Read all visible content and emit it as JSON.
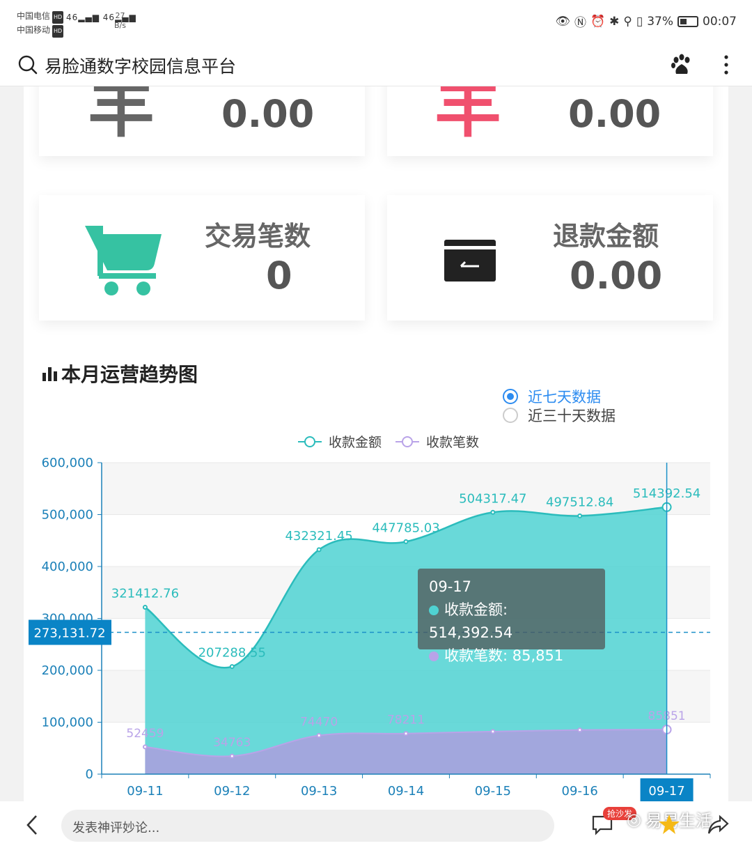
{
  "status_bar": {
    "carrier1": "中国电信",
    "carrier2": "中国移动",
    "hd": "HD",
    "signal": "46",
    "net_speed_value": "27",
    "net_speed_unit": "B/s",
    "battery": "37%",
    "time": "00:07"
  },
  "app_bar": {
    "title": "易脸通数字校园信息平台"
  },
  "cards": {
    "yen_symbol": "羊",
    "card1_value": "0.00",
    "card2_value": "0.00",
    "card3_label": "交易笔数",
    "card3_value": "0",
    "card4_label": "退款金额",
    "card4_value": "0.00"
  },
  "colors": {
    "yen_gray": "#666666",
    "yen_red": "#f0506e",
    "cart_green": "#36c2a2",
    "area_teal": "#4fd2d2",
    "line_teal": "#2bbcbc",
    "area_purple": "#a7a3dd",
    "axis_blue": "#1b80b8"
  },
  "section": {
    "title": "本月运营趋势图",
    "radio_7": "近七天数据",
    "radio_30": "近三十天数据",
    "radio_selected": "近七天数据"
  },
  "chart_data": {
    "type": "area",
    "legend": [
      "收款金额",
      "收款笔数"
    ],
    "categories": [
      "09-11",
      "09-12",
      "09-13",
      "09-14",
      "09-15",
      "09-16",
      "09-17"
    ],
    "series": [
      {
        "name": "收款金额",
        "values": [
          321412.76,
          207288.55,
          432321.45,
          447785.03,
          504317.47,
          497512.84,
          514392.54
        ],
        "labels": [
          "321412.76",
          "207288.55",
          "432321.45",
          "447785.03",
          "504317.47",
          "497512.84",
          "514392.54"
        ]
      },
      {
        "name": "收款笔数",
        "values": [
          52459,
          34763,
          74470,
          78211,
          82000,
          85000,
          85851
        ],
        "labels": [
          "52459",
          "34763",
          "74470",
          "78211",
          "",
          "",
          "85851"
        ]
      }
    ],
    "yticks": [
      "600,000",
      "500,000",
      "400,000",
      "300,000",
      "200,000",
      "100,000",
      "0"
    ],
    "ylim": [
      0,
      600000
    ],
    "crosshair_value": 273131.72,
    "crosshair_label": "273,131.72",
    "highlight_category": "09-17"
  },
  "tooltip": {
    "title": "09-17",
    "row1_label": "收款金额: 514,392.54",
    "row2_label": "收款笔数: 85,851"
  },
  "bottom_bar": {
    "comment_placeholder": "发表神评妙论...",
    "badge": "抢沙发",
    "watermark": "易易生活"
  }
}
